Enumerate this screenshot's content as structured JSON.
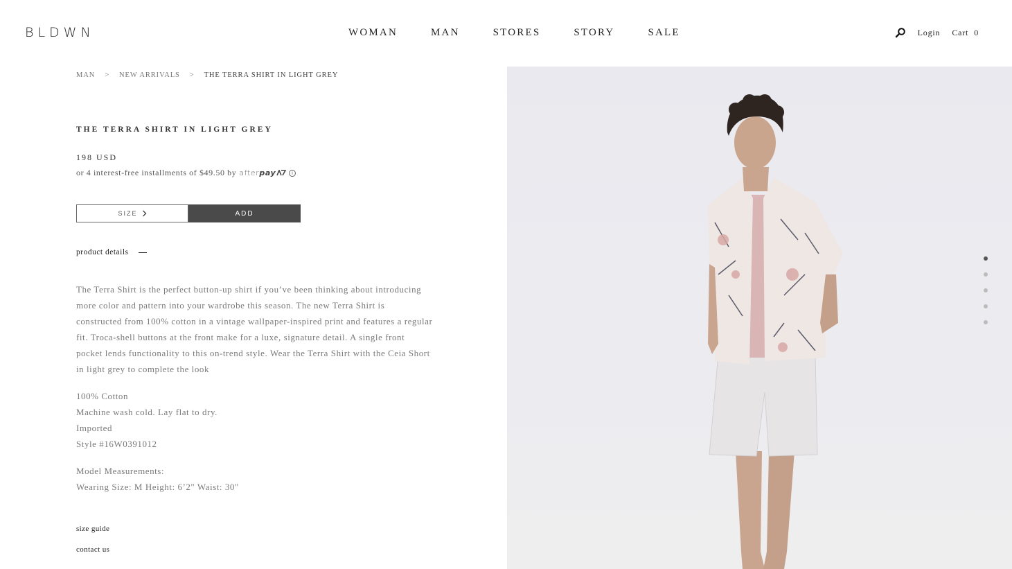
{
  "brand": {
    "logo": "BLDWN"
  },
  "nav": {
    "items": [
      "WOMAN",
      "MAN",
      "STORES",
      "STORY",
      "SALE"
    ]
  },
  "utility": {
    "login": "Login",
    "cart_label": "Cart",
    "cart_count": "0",
    "search_icon": "search-icon"
  },
  "breadcrumb": {
    "items": [
      "MAN",
      "NEW ARRIVALS",
      "THE TERRA SHIRT IN LIGHT GREY"
    ],
    "separator": ">"
  },
  "product": {
    "title": "THE TERRA SHIRT IN LIGHT GREY",
    "price": "198 USD",
    "installments": "or 4 interest-free installments of $49.50 by",
    "afterpay_light": "after",
    "afterpay_bold": "pay",
    "size_label": "SIZE",
    "add_label": "ADD",
    "details_label": "product details",
    "description": "The Terra Shirt is the perfect button-up shirt if you’ve been thinking about introducing more color and pattern into your wardrobe this season. The new Terra Shirt is constructed from 100% cotton in a vintage wallpaper-inspired print and features a regular fit. Troca-shell buttons at the front make for a luxe, signature detail. A single front pocket lends functionality to this on-trend style. Wear the Terra Shirt with the Ceia Short in light grey to complete the look",
    "specs": [
      "100% Cotton",
      "Machine wash cold. Lay flat to dry.",
      "Imported",
      "Style #16W0391012"
    ],
    "measurements": [
      "Model Measurements:",
      "Wearing Size: M Height: 6’2\" Waist: 30\""
    ]
  },
  "links": {
    "size_guide": "size guide",
    "contact": "contact us"
  },
  "gallery": {
    "slide_count": 5,
    "active_index": 0
  },
  "colors": {
    "button_dark": "#4a4a4a",
    "text_muted": "#7a7a7a",
    "image_bg": "#eaeaef"
  }
}
